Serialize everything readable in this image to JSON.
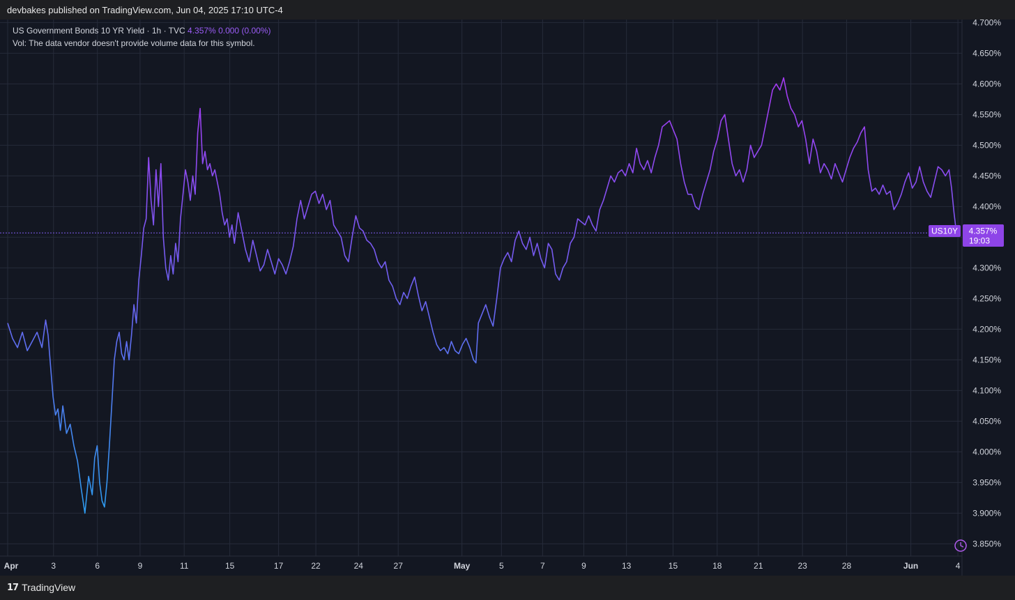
{
  "header": {
    "published": "devbakes published on TradingView.com, Jun 04, 2025 17:10 UTC-4"
  },
  "legend": {
    "symbol": "US Government Bonds 10 YR Yield · 1h · TVC",
    "last": "4.357%",
    "change": "0.000 (0.00%)",
    "vol_note": "Vol: The data vendor doesn't provide volume data for this symbol."
  },
  "price_tag": {
    "ticker": "US10Y",
    "value": "4.357%",
    "countdown": "19:03"
  },
  "footer": {
    "brand": "TradingView",
    "logo_glyph": "17"
  },
  "colors": {
    "background": "#131722",
    "grid": "#262b3a",
    "line_low": "#2e9bf0",
    "line_mid": "#6b62f0",
    "line_high": "#a23bf0",
    "price_tag": "#8e44e8"
  },
  "chart_data": {
    "type": "line",
    "y_unit": "%",
    "ylim": [
      3.83,
      4.705
    ],
    "y_ticks": [
      "4.700%",
      "4.650%",
      "4.600%",
      "4.550%",
      "4.500%",
      "4.450%",
      "4.400%",
      "4.350%",
      "4.300%",
      "4.250%",
      "4.200%",
      "4.150%",
      "4.100%",
      "4.050%",
      "4.000%",
      "3.950%",
      "3.900%",
      "3.850%"
    ],
    "x_ticks": [
      {
        "label": "Apr",
        "x": 0,
        "bold": true
      },
      {
        "label": "3",
        "x": 1.87
      },
      {
        "label": "6",
        "x": 3.66
      },
      {
        "label": "9",
        "x": 5.4
      },
      {
        "label": "11",
        "x": 7.2
      },
      {
        "label": "15",
        "x": 9.06
      },
      {
        "label": "17",
        "x": 11.05
      },
      {
        "label": "22",
        "x": 12.57
      },
      {
        "label": "24",
        "x": 14.31
      },
      {
        "label": "27",
        "x": 15.93
      },
      {
        "label": "May",
        "x": 18.53,
        "bold": true
      },
      {
        "label": "5",
        "x": 20.14
      },
      {
        "label": "7",
        "x": 21.82
      },
      {
        "label": "9",
        "x": 23.5
      },
      {
        "label": "13",
        "x": 25.24
      },
      {
        "label": "15",
        "x": 27.14
      },
      {
        "label": "18",
        "x": 28.94
      },
      {
        "label": "21",
        "x": 30.62
      },
      {
        "label": "23",
        "x": 32.42
      },
      {
        "label": "28",
        "x": 34.22
      },
      {
        "label": "Jun",
        "x": 36.84,
        "bold": true
      },
      {
        "label": "4",
        "x": 38.76
      }
    ],
    "grid": true,
    "last_value": 4.357,
    "series": [
      {
        "points": [
          [
            0,
            4.21
          ],
          [
            0.2,
            4.185
          ],
          [
            0.4,
            4.17
          ],
          [
            0.6,
            4.195
          ],
          [
            0.8,
            4.165
          ],
          [
            1.0,
            4.18
          ],
          [
            1.2,
            4.195
          ],
          [
            1.4,
            4.17
          ],
          [
            1.55,
            4.215
          ],
          [
            1.65,
            4.19
          ],
          [
            1.75,
            4.14
          ],
          [
            1.85,
            4.09
          ],
          [
            1.95,
            4.06
          ],
          [
            2.05,
            4.07
          ],
          [
            2.15,
            4.035
          ],
          [
            2.25,
            4.075
          ],
          [
            2.4,
            4.03
          ],
          [
            2.55,
            4.045
          ],
          [
            2.7,
            4.01
          ],
          [
            2.85,
            3.985
          ],
          [
            3.0,
            3.94
          ],
          [
            3.15,
            3.9
          ],
          [
            3.3,
            3.96
          ],
          [
            3.45,
            3.93
          ],
          [
            3.55,
            3.99
          ],
          [
            3.65,
            4.01
          ],
          [
            3.75,
            3.95
          ],
          [
            3.85,
            3.92
          ],
          [
            3.95,
            3.91
          ],
          [
            4.05,
            3.95
          ],
          [
            4.15,
            4.01
          ],
          [
            4.25,
            4.08
          ],
          [
            4.35,
            4.15
          ],
          [
            4.45,
            4.18
          ],
          [
            4.55,
            4.195
          ],
          [
            4.65,
            4.16
          ],
          [
            4.75,
            4.15
          ],
          [
            4.85,
            4.18
          ],
          [
            4.95,
            4.15
          ],
          [
            5.05,
            4.19
          ],
          [
            5.15,
            4.24
          ],
          [
            5.25,
            4.21
          ],
          [
            5.35,
            4.28
          ],
          [
            5.45,
            4.32
          ],
          [
            5.55,
            4.365
          ],
          [
            5.65,
            4.38
          ],
          [
            5.75,
            4.48
          ],
          [
            5.85,
            4.41
          ],
          [
            5.95,
            4.37
          ],
          [
            6.05,
            4.46
          ],
          [
            6.15,
            4.4
          ],
          [
            6.25,
            4.47
          ],
          [
            6.35,
            4.35
          ],
          [
            6.45,
            4.3
          ],
          [
            6.55,
            4.28
          ],
          [
            6.65,
            4.32
          ],
          [
            6.75,
            4.29
          ],
          [
            6.85,
            4.34
          ],
          [
            6.95,
            4.31
          ],
          [
            7.05,
            4.38
          ],
          [
            7.15,
            4.42
          ],
          [
            7.25,
            4.46
          ],
          [
            7.35,
            4.44
          ],
          [
            7.45,
            4.41
          ],
          [
            7.55,
            4.45
          ],
          [
            7.65,
            4.42
          ],
          [
            7.75,
            4.52
          ],
          [
            7.85,
            4.56
          ],
          [
            7.95,
            4.47
          ],
          [
            8.05,
            4.49
          ],
          [
            8.15,
            4.46
          ],
          [
            8.25,
            4.47
          ],
          [
            8.35,
            4.45
          ],
          [
            8.45,
            4.46
          ],
          [
            8.55,
            4.44
          ],
          [
            8.65,
            4.42
          ],
          [
            8.75,
            4.39
          ],
          [
            8.85,
            4.37
          ],
          [
            8.95,
            4.38
          ],
          [
            9.05,
            4.35
          ],
          [
            9.15,
            4.37
          ],
          [
            9.25,
            4.34
          ],
          [
            9.4,
            4.39
          ],
          [
            9.55,
            4.36
          ],
          [
            9.7,
            4.33
          ],
          [
            9.85,
            4.31
          ],
          [
            10.0,
            4.345
          ],
          [
            10.15,
            4.32
          ],
          [
            10.3,
            4.295
          ],
          [
            10.45,
            4.305
          ],
          [
            10.6,
            4.33
          ],
          [
            10.75,
            4.31
          ],
          [
            10.9,
            4.29
          ],
          [
            11.05,
            4.315
          ],
          [
            11.2,
            4.305
          ],
          [
            11.35,
            4.29
          ],
          [
            11.5,
            4.31
          ],
          [
            11.65,
            4.335
          ],
          [
            11.8,
            4.38
          ],
          [
            11.95,
            4.41
          ],
          [
            12.1,
            4.38
          ],
          [
            12.25,
            4.4
          ],
          [
            12.4,
            4.42
          ],
          [
            12.55,
            4.425
          ],
          [
            12.7,
            4.405
          ],
          [
            12.85,
            4.42
          ],
          [
            13.0,
            4.395
          ],
          [
            13.15,
            4.41
          ],
          [
            13.3,
            4.37
          ],
          [
            13.45,
            4.36
          ],
          [
            13.6,
            4.35
          ],
          [
            13.75,
            4.32
          ],
          [
            13.9,
            4.31
          ],
          [
            14.05,
            4.35
          ],
          [
            14.2,
            4.385
          ],
          [
            14.35,
            4.365
          ],
          [
            14.5,
            4.36
          ],
          [
            14.65,
            4.345
          ],
          [
            14.8,
            4.34
          ],
          [
            14.95,
            4.33
          ],
          [
            15.1,
            4.31
          ],
          [
            15.25,
            4.3
          ],
          [
            15.4,
            4.31
          ],
          [
            15.55,
            4.28
          ],
          [
            15.7,
            4.27
          ],
          [
            15.85,
            4.25
          ],
          [
            16.0,
            4.24
          ],
          [
            16.15,
            4.26
          ],
          [
            16.3,
            4.25
          ],
          [
            16.45,
            4.27
          ],
          [
            16.6,
            4.285
          ],
          [
            16.75,
            4.255
          ],
          [
            16.9,
            4.23
          ],
          [
            17.05,
            4.245
          ],
          [
            17.2,
            4.22
          ],
          [
            17.35,
            4.195
          ],
          [
            17.5,
            4.175
          ],
          [
            17.65,
            4.165
          ],
          [
            17.8,
            4.17
          ],
          [
            17.95,
            4.16
          ],
          [
            18.1,
            4.18
          ],
          [
            18.25,
            4.165
          ],
          [
            18.4,
            4.16
          ],
          [
            18.55,
            4.175
          ],
          [
            18.7,
            4.185
          ],
          [
            18.85,
            4.17
          ],
          [
            19.0,
            4.15
          ],
          [
            19.1,
            4.145
          ],
          [
            19.2,
            4.21
          ],
          [
            19.35,
            4.225
          ],
          [
            19.5,
            4.24
          ],
          [
            19.65,
            4.22
          ],
          [
            19.8,
            4.205
          ],
          [
            19.95,
            4.25
          ],
          [
            20.1,
            4.3
          ],
          [
            20.25,
            4.315
          ],
          [
            20.4,
            4.325
          ],
          [
            20.55,
            4.31
          ],
          [
            20.7,
            4.345
          ],
          [
            20.85,
            4.36
          ],
          [
            21.0,
            4.34
          ],
          [
            21.15,
            4.33
          ],
          [
            21.3,
            4.35
          ],
          [
            21.45,
            4.32
          ],
          [
            21.6,
            4.34
          ],
          [
            21.75,
            4.315
          ],
          [
            21.9,
            4.3
          ],
          [
            22.05,
            4.34
          ],
          [
            22.2,
            4.33
          ],
          [
            22.35,
            4.29
          ],
          [
            22.5,
            4.28
          ],
          [
            22.65,
            4.3
          ],
          [
            22.8,
            4.31
          ],
          [
            22.95,
            4.34
          ],
          [
            23.1,
            4.35
          ],
          [
            23.25,
            4.38
          ],
          [
            23.4,
            4.375
          ],
          [
            23.55,
            4.37
          ],
          [
            23.7,
            4.385
          ],
          [
            23.85,
            4.37
          ],
          [
            24.0,
            4.36
          ],
          [
            24.15,
            4.395
          ],
          [
            24.3,
            4.41
          ],
          [
            24.45,
            4.43
          ],
          [
            24.6,
            4.45
          ],
          [
            24.75,
            4.44
          ],
          [
            24.9,
            4.455
          ],
          [
            25.05,
            4.46
          ],
          [
            25.2,
            4.45
          ],
          [
            25.35,
            4.47
          ],
          [
            25.5,
            4.455
          ],
          [
            25.65,
            4.495
          ],
          [
            25.8,
            4.47
          ],
          [
            25.95,
            4.46
          ],
          [
            26.1,
            4.475
          ],
          [
            26.25,
            4.455
          ],
          [
            26.4,
            4.48
          ],
          [
            26.55,
            4.5
          ],
          [
            26.7,
            4.53
          ],
          [
            26.85,
            4.535
          ],
          [
            27.0,
            4.54
          ],
          [
            27.15,
            4.525
          ],
          [
            27.3,
            4.51
          ],
          [
            27.45,
            4.47
          ],
          [
            27.6,
            4.44
          ],
          [
            27.75,
            4.42
          ],
          [
            27.9,
            4.42
          ],
          [
            28.05,
            4.4
          ],
          [
            28.2,
            4.395
          ],
          [
            28.35,
            4.42
          ],
          [
            28.5,
            4.44
          ],
          [
            28.65,
            4.46
          ],
          [
            28.8,
            4.49
          ],
          [
            28.95,
            4.51
          ],
          [
            29.1,
            4.54
          ],
          [
            29.25,
            4.55
          ],
          [
            29.4,
            4.51
          ],
          [
            29.55,
            4.47
          ],
          [
            29.7,
            4.45
          ],
          [
            29.85,
            4.46
          ],
          [
            30.0,
            4.44
          ],
          [
            30.15,
            4.46
          ],
          [
            30.3,
            4.5
          ],
          [
            30.45,
            4.48
          ],
          [
            30.6,
            4.49
          ],
          [
            30.75,
            4.5
          ],
          [
            30.9,
            4.53
          ],
          [
            31.05,
            4.56
          ],
          [
            31.2,
            4.59
          ],
          [
            31.35,
            4.6
          ],
          [
            31.5,
            4.59
          ],
          [
            31.65,
            4.61
          ],
          [
            31.8,
            4.58
          ],
          [
            31.95,
            4.56
          ],
          [
            32.1,
            4.55
          ],
          [
            32.25,
            4.53
          ],
          [
            32.4,
            4.54
          ],
          [
            32.55,
            4.51
          ],
          [
            32.7,
            4.47
          ],
          [
            32.85,
            4.51
          ],
          [
            33.0,
            4.49
          ],
          [
            33.15,
            4.455
          ],
          [
            33.3,
            4.47
          ],
          [
            33.45,
            4.46
          ],
          [
            33.6,
            4.445
          ],
          [
            33.75,
            4.47
          ],
          [
            33.9,
            4.455
          ],
          [
            34.05,
            4.44
          ],
          [
            34.2,
            4.46
          ],
          [
            34.35,
            4.48
          ],
          [
            34.5,
            4.495
          ],
          [
            34.65,
            4.505
          ],
          [
            34.8,
            4.52
          ],
          [
            34.95,
            4.53
          ],
          [
            35.1,
            4.46
          ],
          [
            35.25,
            4.425
          ],
          [
            35.4,
            4.43
          ],
          [
            35.55,
            4.42
          ],
          [
            35.7,
            4.435
          ],
          [
            35.85,
            4.42
          ],
          [
            36.0,
            4.425
          ],
          [
            36.15,
            4.395
          ],
          [
            36.3,
            4.405
          ],
          [
            36.45,
            4.42
          ],
          [
            36.6,
            4.44
          ],
          [
            36.75,
            4.455
          ],
          [
            36.9,
            4.43
          ],
          [
            37.05,
            4.44
          ],
          [
            37.2,
            4.465
          ],
          [
            37.35,
            4.44
          ],
          [
            37.5,
            4.425
          ],
          [
            37.65,
            4.415
          ],
          [
            37.8,
            4.44
          ],
          [
            37.95,
            4.465
          ],
          [
            38.1,
            4.46
          ],
          [
            38.25,
            4.45
          ],
          [
            38.4,
            4.46
          ],
          [
            38.5,
            4.43
          ],
          [
            38.6,
            4.39
          ],
          [
            38.7,
            4.357
          ]
        ]
      }
    ]
  }
}
